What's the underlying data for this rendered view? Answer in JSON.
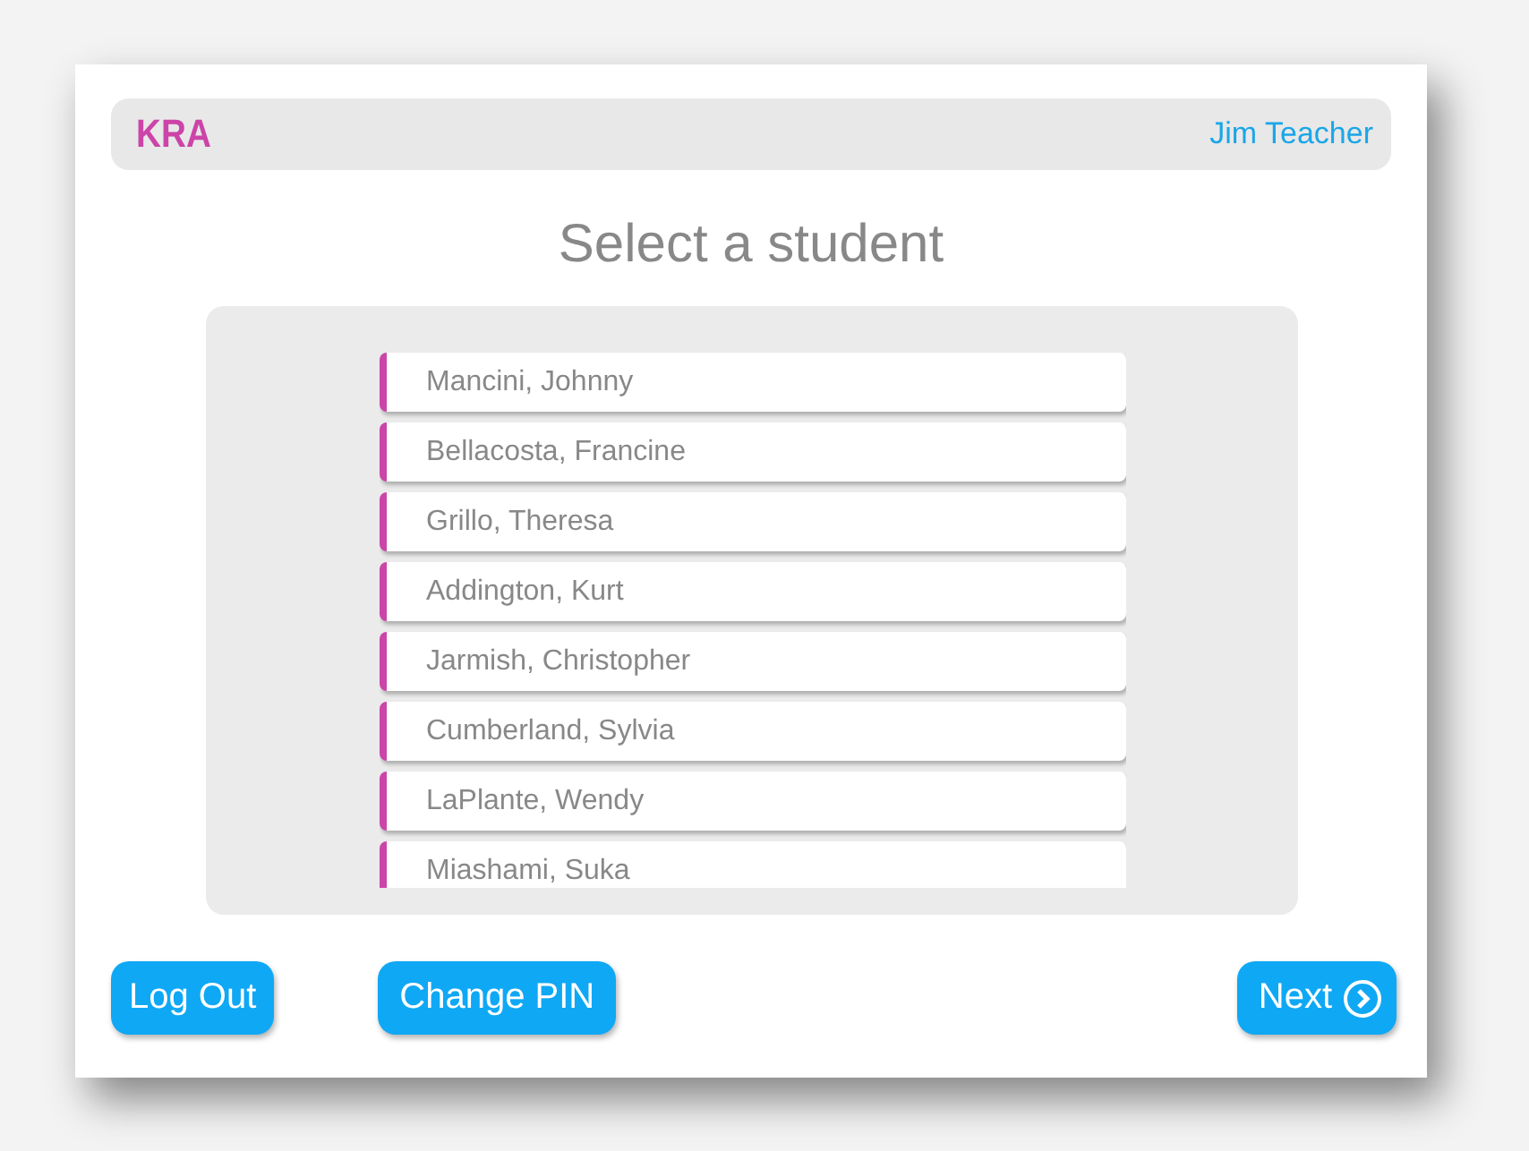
{
  "header": {
    "logo": "KRA",
    "user": "Jim Teacher"
  },
  "title": "Select a student",
  "students": [
    {
      "name": "Mancini, Johnny"
    },
    {
      "name": "Bellacosta, Francine"
    },
    {
      "name": "Grillo, Theresa"
    },
    {
      "name": "Addington, Kurt"
    },
    {
      "name": "Jarmish, Christopher"
    },
    {
      "name": "Cumberland, Sylvia"
    },
    {
      "name": "LaPlante, Wendy"
    },
    {
      "name": "Miashami, Suka"
    }
  ],
  "buttons": {
    "log_out": "Log Out",
    "change_pin": "Change PIN",
    "next": "Next"
  }
}
